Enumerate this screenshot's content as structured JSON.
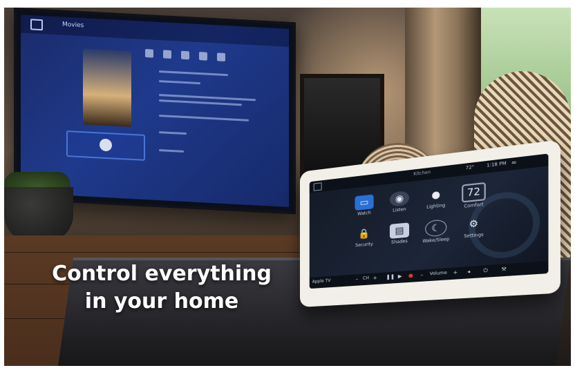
{
  "headline": {
    "line1": "Control everything",
    "line2": "in your home"
  },
  "tablet": {
    "status": {
      "room": "Kitchen",
      "temp": "72°",
      "time": "1:18 PM"
    },
    "thermostat_value": "72",
    "tiles": [
      {
        "label": "Watch",
        "icon": "tv-icon"
      },
      {
        "label": "Listen",
        "icon": "speaker-icon"
      },
      {
        "label": "Lighting",
        "icon": "bulb-icon"
      },
      {
        "label": "Comfort",
        "icon": "thermostat-icon"
      },
      {
        "label": "Security",
        "icon": "lock-icon"
      },
      {
        "label": "Shades",
        "icon": "shades-icon"
      },
      {
        "label": "Wake/Sleep",
        "icon": "moon-icon"
      },
      {
        "label": "Settings",
        "icon": "gear-icon"
      }
    ],
    "transport": {
      "source": "Apple TV",
      "ch": "CH",
      "volume": "Volume"
    }
  },
  "tv": {
    "title": "Movies"
  },
  "colors": {
    "tablet_bezel": "#f2efe8",
    "tablet_screen": "#141a26",
    "tv_screen": "#1f3a8c",
    "record": "#e53935"
  }
}
